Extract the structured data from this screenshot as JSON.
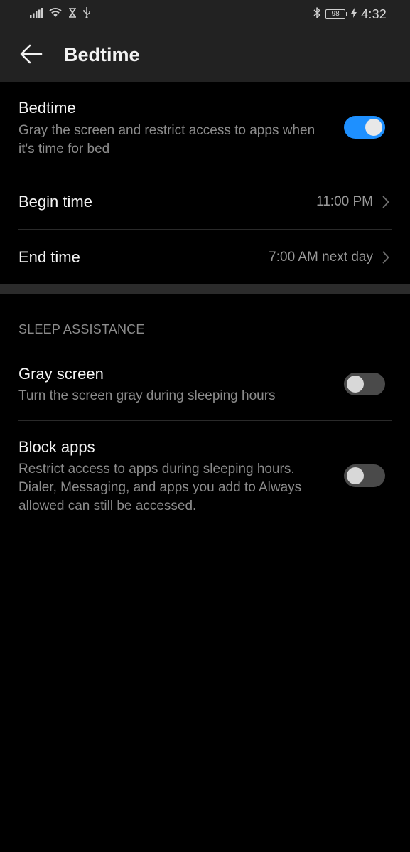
{
  "status_bar": {
    "time": "4:32",
    "battery_level": "98",
    "icons": [
      "signal-icon",
      "wifi-icon",
      "hourglass-icon",
      "usb-icon",
      "bluetooth-icon",
      "battery-icon",
      "charging-icon"
    ]
  },
  "app_bar": {
    "title": "Bedtime",
    "back_icon": "arrow-left-icon"
  },
  "bedtime": {
    "title": "Bedtime",
    "subtitle": "Gray the screen and restrict access to apps when it's time for bed",
    "enabled": true
  },
  "begin_time": {
    "label": "Begin time",
    "value": "11:00 PM"
  },
  "end_time": {
    "label": "End time",
    "value": "7:00 AM next day"
  },
  "sleep_assistance": {
    "header": "SLEEP ASSISTANCE",
    "gray_screen": {
      "title": "Gray screen",
      "subtitle": "Turn the screen gray during sleeping hours",
      "enabled": false
    },
    "block_apps": {
      "title": "Block apps",
      "subtitle": "Restrict access to apps during sleeping hours. Dialer, Messaging, and apps you add to Always allowed can still be accessed.",
      "enabled": false
    }
  },
  "colors": {
    "accent": "#1e90ff",
    "background": "#000000",
    "app_bar": "#222222",
    "secondary_text": "#8c8c8c"
  }
}
